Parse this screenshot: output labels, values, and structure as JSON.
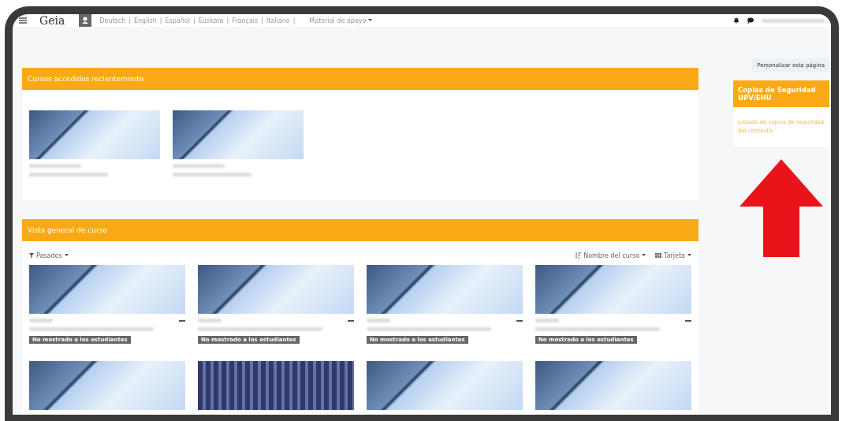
{
  "top_bar": {
    "logo": "Geia",
    "languages": [
      "Deutsch",
      "English",
      "Español",
      "Euskara",
      "Français",
      "Italiano"
    ],
    "separator": "|",
    "menu": "Material de apoyo"
  },
  "customize_button": "Personalizar esta página",
  "recent": {
    "title": "Cursos accedidos recientemente",
    "courses": [
      {
        "kind": "photo"
      },
      {
        "kind": "photo"
      }
    ]
  },
  "overview": {
    "title": "Vista general de curso",
    "filter": "Pasados",
    "sort": "Nombre del curso",
    "view": "Tarjeta",
    "courses": [
      {
        "kind": "photo",
        "badge": "No mostrado a los estudiantes"
      },
      {
        "kind": "photo",
        "badge": "No mostrado a los estudiantes"
      },
      {
        "kind": "photo",
        "badge": "No mostrado a los estudiantes"
      },
      {
        "kind": "photo",
        "badge": "No mostrado a los estudiantes"
      },
      {
        "kind": "photo"
      },
      {
        "kind": "pattern"
      },
      {
        "kind": "photo"
      },
      {
        "kind": "photo"
      }
    ]
  },
  "sidebar_block": {
    "title": "Copias de Seguridad UPV/EHU",
    "link": "Listado de copias de seguridad del contexto"
  }
}
